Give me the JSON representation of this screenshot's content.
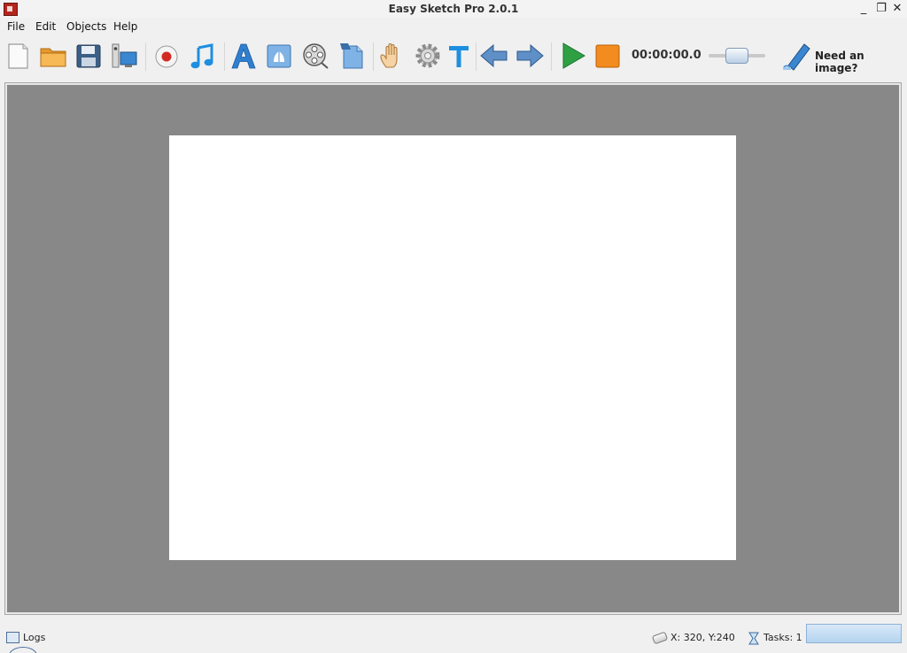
{
  "window": {
    "title": "Easy Sketch Pro 2.0.1",
    "minimize_glyph": "_",
    "maximize_glyph": "❐",
    "close_glyph": "✕"
  },
  "menu": {
    "items": [
      "File",
      "Edit",
      "Objects",
      "Help"
    ]
  },
  "toolbar": {
    "buttons": [
      {
        "name": "new-document",
        "icon": "blank-page-icon"
      },
      {
        "name": "open-project",
        "icon": "folder-icon"
      },
      {
        "name": "save-project",
        "icon": "floppy-disk-icon"
      },
      {
        "name": "export",
        "icon": "computer-export-icon"
      },
      {
        "name": "record",
        "icon": "record-icon"
      },
      {
        "name": "music",
        "icon": "music-note-icon"
      },
      {
        "name": "add-text",
        "icon": "letter-a-icon"
      },
      {
        "name": "add-image",
        "icon": "image-icon"
      },
      {
        "name": "add-video",
        "icon": "film-reel-icon"
      },
      {
        "name": "add-file",
        "icon": "document-icon"
      },
      {
        "name": "hand",
        "icon": "hand-icon"
      },
      {
        "name": "settings",
        "icon": "gear-icon"
      },
      {
        "name": "text-tool",
        "icon": "text-t-icon"
      },
      {
        "name": "previous",
        "icon": "arrow-left-icon"
      },
      {
        "name": "next",
        "icon": "arrow-right-icon"
      },
      {
        "name": "play",
        "icon": "play-icon"
      },
      {
        "name": "stop",
        "icon": "stop-icon"
      }
    ],
    "timer": "00:00:00.0",
    "slider_level": 0.5,
    "need_image_label": "Need an image?"
  },
  "colors": {
    "workspace": "#888888",
    "canvas": "#ffffff",
    "play": "#2ea043",
    "stop": "#f28c1e",
    "accent_blue": "#2f7fd0"
  },
  "status": {
    "logs_label": "Logs",
    "coords_label": "X: 320, Y:240",
    "tasks_label": "Tasks: 1"
  }
}
